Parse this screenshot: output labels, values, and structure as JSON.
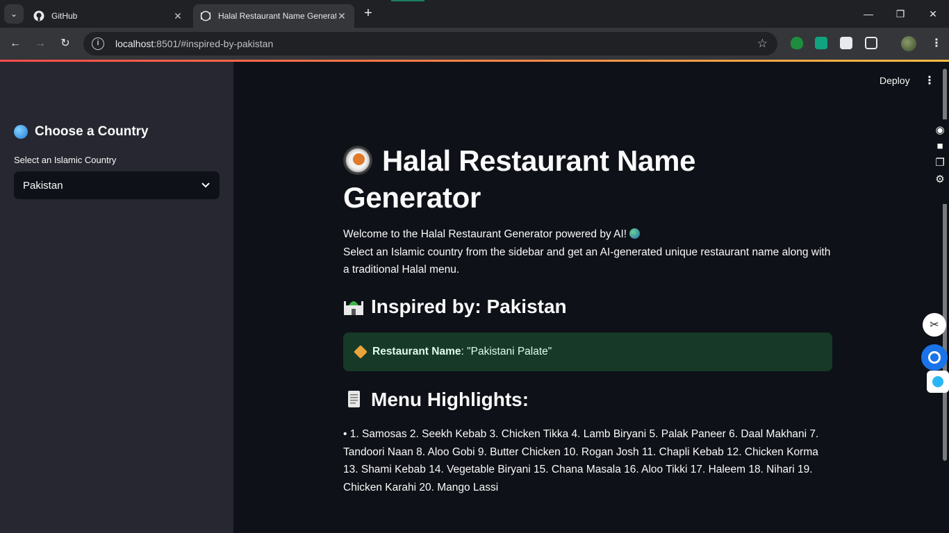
{
  "browser": {
    "tabs": [
      {
        "title": "GitHub",
        "icon": "github-icon"
      },
      {
        "title": "Halal Restaurant Name Generat",
        "icon": "plate-icon"
      }
    ],
    "address": {
      "host": "localhost",
      "path": ":8501/#inspired-by-pakistan"
    }
  },
  "app": {
    "deploy_label": "Deploy",
    "sidebar": {
      "header": "Choose a Country",
      "select_label": "Select an Islamic Country",
      "selected_country": "Pakistan"
    },
    "main": {
      "title": "Halal Restaurant Name Generator",
      "intro_line1": "Welcome to the Halal Restaurant Generator powered by AI!",
      "intro_line2": "Select an Islamic country from the sidebar and get an AI-generated unique restaurant name along with a traditional Halal menu.",
      "inspired_heading": "Inspired by: Pakistan",
      "restaurant_label": "Restaurant Name",
      "restaurant_value": ": \"Pakistani Palate\"",
      "menu_heading": "Menu Highlights:",
      "menu_items": "• 1. Samosas 2. Seekh Kebab 3. Chicken Tikka 4. Lamb Biryani 5. Palak Paneer 6. Daal Makhani 7. Tandoori Naan 8. Aloo Gobi 9. Butter Chicken 10. Rogan Josh 11. Chapli Kebab 12. Chicken Korma 13. Shami Kebab 14. Vegetable Biryani 15. Chana Masala 16. Aloo Tikki 17. Haleem 18. Nihari 19. Chicken Karahi 20. Mango Lassi"
    }
  },
  "colors": {
    "sidebar_bg": "#262730",
    "main_bg": "#0e1117",
    "success_bg": "#173928",
    "text": "#fafafa"
  }
}
